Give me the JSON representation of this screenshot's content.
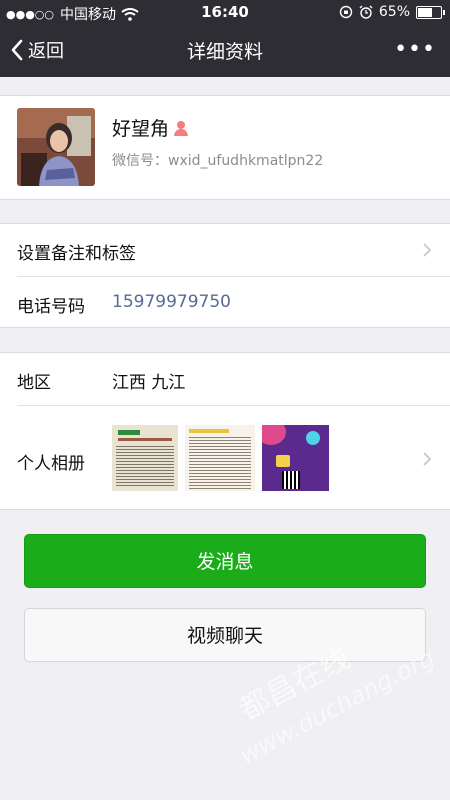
{
  "status_bar": {
    "carrier": "中国移动",
    "time": "16:40",
    "battery": "65%",
    "battery_level": 0.65
  },
  "nav": {
    "back_label": "返回",
    "title": "详细资料"
  },
  "profile": {
    "name": "好望角",
    "wxid": "微信号：wxid_ufudhkmatlpn22",
    "gender": "female"
  },
  "rows": {
    "remark": "设置备注和标签",
    "phone_label": "电话号码",
    "phone": "15979979750",
    "region_label": "地区",
    "region": "江西 九江",
    "album_label": "个人相册"
  },
  "buttons": {
    "message": "发消息",
    "video": "视频聊天"
  },
  "watermark": {
    "line1": "都昌在线",
    "line2": "www.duchang.org"
  },
  "colors": {
    "nav_bg": "#2e2d33",
    "accent_green": "#1aad19",
    "link_blue": "#576b95"
  }
}
